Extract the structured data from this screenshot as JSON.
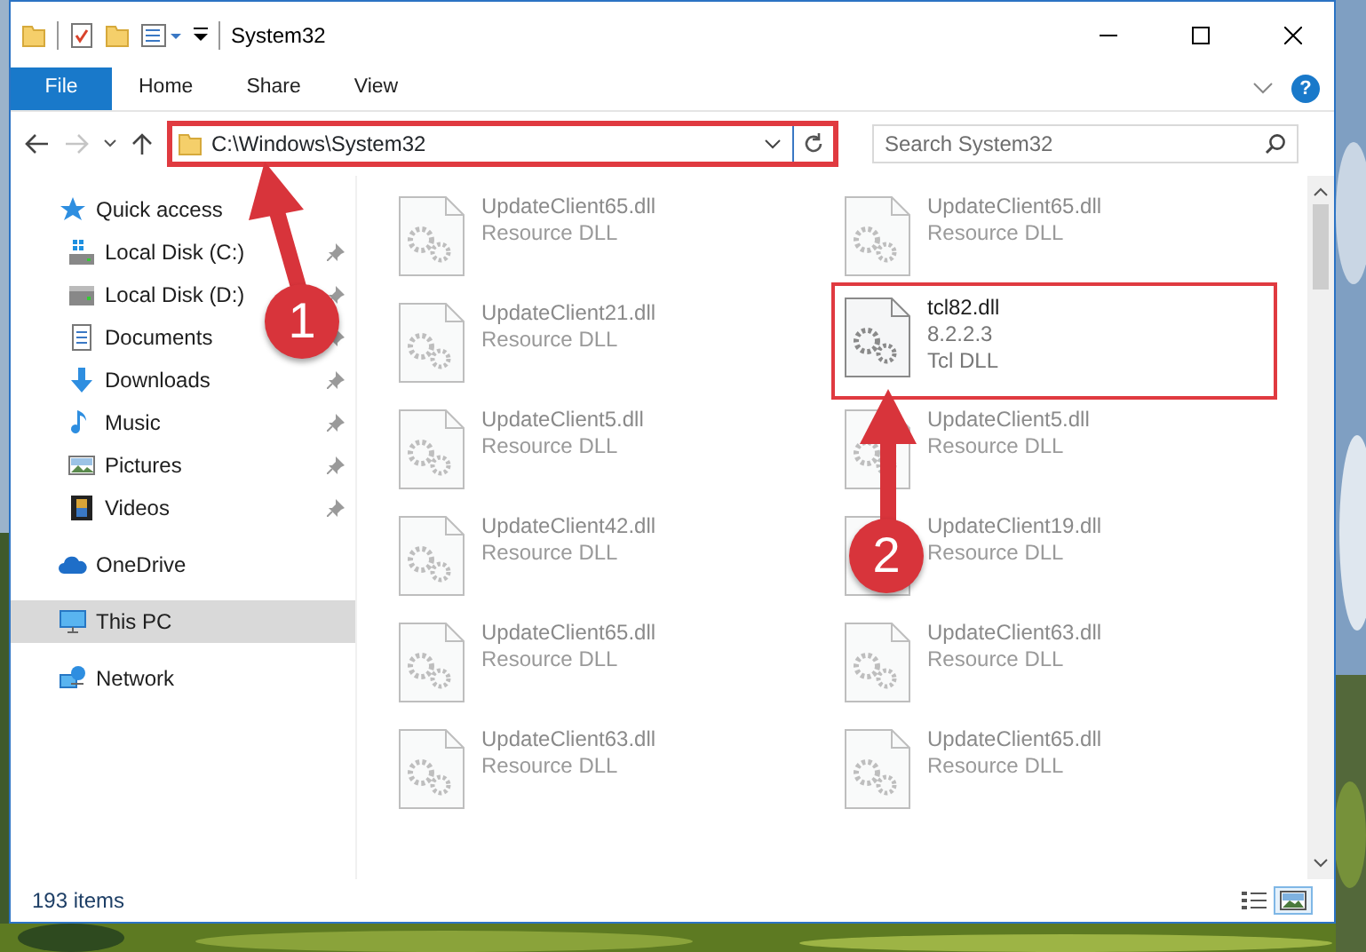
{
  "window": {
    "title": "System32"
  },
  "ribbon": {
    "tabs": [
      {
        "label": "File",
        "kind": "file"
      },
      {
        "label": "Home",
        "kind": "tab"
      },
      {
        "label": "Share",
        "kind": "tab"
      },
      {
        "label": "View",
        "kind": "tab"
      }
    ],
    "help": "?"
  },
  "address": {
    "path": "C:\\Windows\\System32",
    "highlighted": true
  },
  "search": {
    "placeholder": "Search System32"
  },
  "sidebar": {
    "items": [
      {
        "label": "Quick access",
        "kind": "star",
        "selected": false,
        "children": [
          {
            "label": "Local Disk (C:)",
            "kind": "drive-win",
            "pinned": true,
            "selected": false
          },
          {
            "label": "Local Disk (D:)",
            "kind": "drive",
            "pinned": true,
            "selected": false
          },
          {
            "label": "Documents",
            "kind": "document",
            "pinned": true,
            "selected": false
          },
          {
            "label": "Downloads",
            "kind": "download",
            "pinned": true,
            "selected": false
          },
          {
            "label": "Music",
            "kind": "music",
            "pinned": true,
            "selected": false
          },
          {
            "label": "Pictures",
            "kind": "pictures",
            "pinned": true,
            "selected": false
          },
          {
            "label": "Videos",
            "kind": "videos",
            "pinned": true,
            "selected": false
          }
        ]
      },
      {
        "label": "OneDrive",
        "kind": "cloud",
        "selected": false
      },
      {
        "label": "This PC",
        "kind": "pc",
        "selected": true
      },
      {
        "label": "Network",
        "kind": "network",
        "selected": false
      }
    ]
  },
  "files": [
    {
      "name": "UpdateClient65.dll",
      "details": [
        "Resource DLL"
      ],
      "highlighted": false
    },
    {
      "name": "UpdateClient65.dll",
      "details": [
        "Resource DLL"
      ],
      "highlighted": false
    },
    {
      "name": "UpdateClient21.dll",
      "details": [
        "Resource DLL"
      ],
      "highlighted": false
    },
    {
      "name": "tcl82.dll",
      "details": [
        "8.2.2.3",
        "Tcl DLL"
      ],
      "highlighted": true
    },
    {
      "name": "UpdateClient5.dll",
      "details": [
        "Resource DLL"
      ],
      "highlighted": false
    },
    {
      "name": "UpdateClient5.dll",
      "details": [
        "Resource DLL"
      ],
      "highlighted": false
    },
    {
      "name": "UpdateClient42.dll",
      "details": [
        "Resource DLL"
      ],
      "highlighted": false
    },
    {
      "name": "UpdateClient19.dll",
      "details": [
        "Resource DLL"
      ],
      "highlighted": false
    },
    {
      "name": "UpdateClient65.dll",
      "details": [
        "Resource DLL"
      ],
      "highlighted": false
    },
    {
      "name": "UpdateClient63.dll",
      "details": [
        "Resource DLL"
      ],
      "highlighted": false
    },
    {
      "name": "UpdateClient63.dll",
      "details": [
        "Resource DLL"
      ],
      "highlighted": false
    },
    {
      "name": "UpdateClient65.dll",
      "details": [
        "Resource DLL"
      ],
      "highlighted": false
    }
  ],
  "status_bar": {
    "text": "193 items",
    "view_buttons": [
      {
        "kind": "details",
        "selected": false
      },
      {
        "kind": "large-icons",
        "selected": true
      }
    ]
  },
  "annotations": [
    {
      "number": "1"
    },
    {
      "number": "2"
    }
  ]
}
